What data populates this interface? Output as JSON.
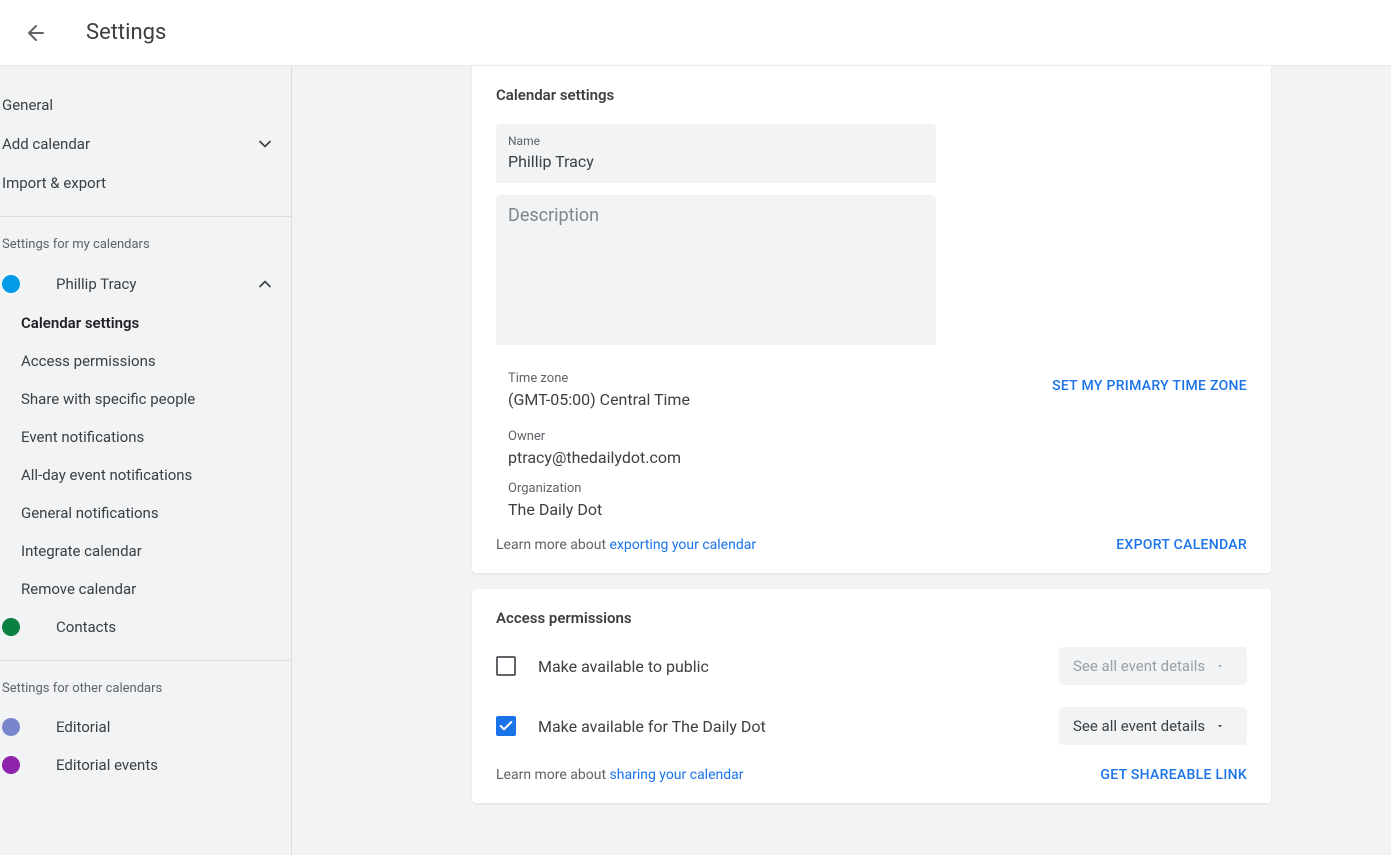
{
  "header": {
    "title": "Settings"
  },
  "sidebar": {
    "top": {
      "general": "General",
      "add_calendar": "Add calendar",
      "import_export": "Import & export"
    },
    "my_cal_section": "Settings for my calendars",
    "cal1": {
      "name": "Phillip Tracy",
      "color": "#039be5",
      "subs": {
        "calendar_settings": "Calendar settings",
        "access_permissions": "Access permissions",
        "share_people": "Share with specific people",
        "event_notifications": "Event notifications",
        "allday_notifications": "All-day event notifications",
        "general_notifications": "General notifications",
        "integrate": "Integrate calendar",
        "remove": "Remove calendar"
      }
    },
    "cal2": {
      "name": "Contacts",
      "color": "#0b8043"
    },
    "other_cal_section": "Settings for other calendars",
    "cal3": {
      "name": "Editorial",
      "color": "#7986cb"
    },
    "cal4": {
      "name": "Editorial events",
      "color": "#8e24aa"
    }
  },
  "calendar_settings": {
    "title": "Calendar settings",
    "name_label": "Name",
    "name_value": "Phillip Tracy",
    "description_label": "Description",
    "timezone_label": "Time zone",
    "timezone_value": "(GMT-05:00) Central Time",
    "set_primary_tz": "SET MY PRIMARY TIME ZONE",
    "owner_label": "Owner",
    "owner_value": "ptracy@thedailydot.com",
    "org_label": "Organization",
    "org_value": "The Daily Dot",
    "learn_prefix": "Learn more about ",
    "learn_link": "exporting your calendar",
    "export_btn": "EXPORT CALENDAR"
  },
  "access_permissions": {
    "title": "Access permissions",
    "cb_public": "Make available to public",
    "cb_public_dd": "See all event details",
    "cb_org": "Make available for The Daily Dot",
    "cb_org_dd": "See all event details",
    "learn_prefix": "Learn more about ",
    "learn_link": "sharing your calendar",
    "share_btn": "GET SHAREABLE LINK"
  }
}
